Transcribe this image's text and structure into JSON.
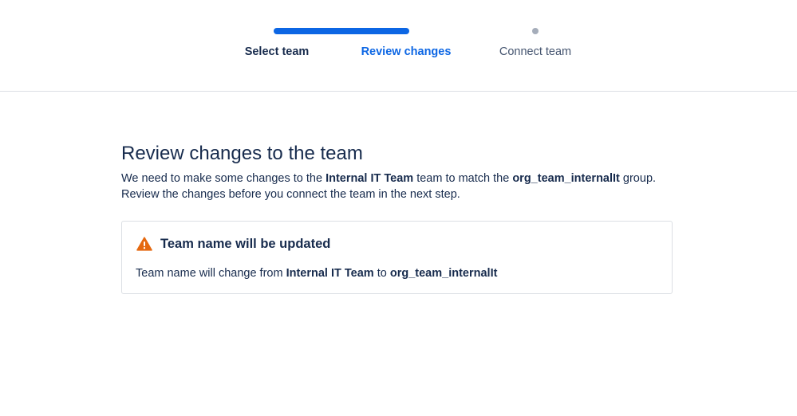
{
  "stepper": {
    "progress_fraction": 0.5,
    "active_color": "#0c66e4",
    "pending_color": "#a5adba",
    "steps": [
      {
        "label": "Select team",
        "state": "completed"
      },
      {
        "label": "Review changes",
        "state": "current"
      },
      {
        "label": "Connect team",
        "state": "pending"
      }
    ]
  },
  "main": {
    "title": "Review changes to the team",
    "description": {
      "part1": "We need to make some changes to the ",
      "team_name": "Internal IT Team",
      "part2": " team to match the ",
      "group_name": "org_team_internalIt",
      "part3": " group.",
      "line2": "Review the changes before you connect the team in the next step."
    }
  },
  "change_card": {
    "icon": "warning-icon",
    "icon_color": "#e56910",
    "title": "Team name will be updated",
    "body_prefix": "Team name will change from ",
    "old_name": "Internal IT Team",
    "connector": " to ",
    "new_name": "org_team_internalIt"
  }
}
